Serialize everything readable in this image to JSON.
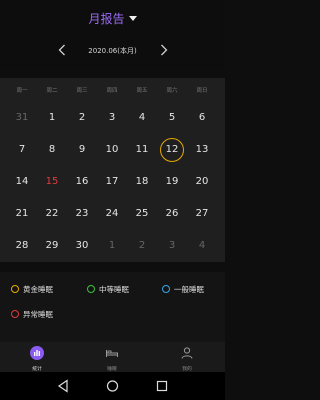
{
  "header": {
    "title": "月报告"
  },
  "month": {
    "label": "2020.06(本月)",
    "prev_icon": "chevron-left-icon",
    "next_icon": "chevron-right-icon"
  },
  "weekdays": [
    "周一",
    "周二",
    "周三",
    "周四",
    "周五",
    "周六",
    "周日"
  ],
  "calendar": {
    "rows": [
      [
        {
          "d": "31",
          "dim": true
        },
        {
          "d": "1"
        },
        {
          "d": "2"
        },
        {
          "d": "3"
        },
        {
          "d": "4"
        },
        {
          "d": "5"
        },
        {
          "d": "6"
        }
      ],
      [
        {
          "d": "7"
        },
        {
          "d": "8"
        },
        {
          "d": "9"
        },
        {
          "d": "10"
        },
        {
          "d": "11"
        },
        {
          "d": "12",
          "ring": true
        },
        {
          "d": "13"
        }
      ],
      [
        {
          "d": "14"
        },
        {
          "d": "15",
          "red": true
        },
        {
          "d": "16"
        },
        {
          "d": "17"
        },
        {
          "d": "18"
        },
        {
          "d": "19"
        },
        {
          "d": "20"
        }
      ],
      [
        {
          "d": "21"
        },
        {
          "d": "22"
        },
        {
          "d": "23"
        },
        {
          "d": "24"
        },
        {
          "d": "25"
        },
        {
          "d": "26"
        },
        {
          "d": "27"
        }
      ],
      [
        {
          "d": "28"
        },
        {
          "d": "29"
        },
        {
          "d": "30"
        },
        {
          "d": "1",
          "dim": true
        },
        {
          "d": "2",
          "dim": true
        },
        {
          "d": "3",
          "dim": true
        },
        {
          "d": "4",
          "dim": true
        }
      ]
    ]
  },
  "legend": [
    {
      "label": "黄金睡眠",
      "color": "#e5a800"
    },
    {
      "label": "中等睡眠",
      "color": "#3cc33c"
    },
    {
      "label": "一般睡眠",
      "color": "#3aa3e6"
    },
    {
      "label": "异常睡眠",
      "color": "#e23a3a"
    }
  ],
  "tabs": [
    {
      "label": "统计",
      "icon": "bar-chart-icon",
      "active": true
    },
    {
      "label": "睡眠",
      "icon": "bed-icon",
      "active": false
    },
    {
      "label": "我的",
      "icon": "person-icon",
      "active": false
    }
  ],
  "system_nav": [
    "back-icon",
    "home-icon",
    "recents-icon"
  ]
}
